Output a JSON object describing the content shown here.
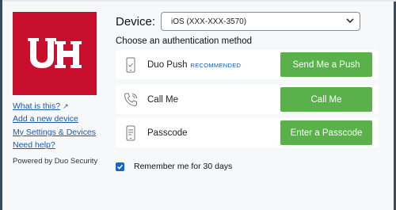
{
  "logo": {
    "text": "UH",
    "color": "#c8102e"
  },
  "links": {
    "what_is_this": "What is this?",
    "add_device": "Add a new device",
    "settings": "My Settings & Devices",
    "help": "Need help?"
  },
  "powered_by": "Powered by Duo Security",
  "device": {
    "label": "Device:",
    "selected": "iOS (XXX-XXX-3570)"
  },
  "choose_label": "Choose an authentication method",
  "methods": [
    {
      "icon": "smartphone-icon",
      "label": "Duo Push",
      "badge": "RECOMMENDED",
      "button": "Send Me a Push"
    },
    {
      "icon": "phone-handset-icon",
      "label": "Call Me",
      "button": "Call Me"
    },
    {
      "icon": "passcode-device-icon",
      "label": "Passcode",
      "button": "Enter a Passcode"
    }
  ],
  "remember": {
    "checked": true,
    "label": "Remember me for 30 days"
  },
  "colors": {
    "accent_button": "#5ab04b",
    "link": "#1a5aa6",
    "checkbox": "#1a63c9"
  }
}
